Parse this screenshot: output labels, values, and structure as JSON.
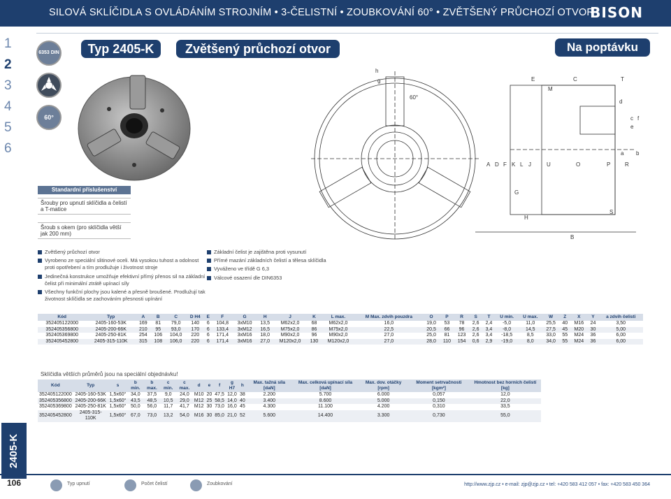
{
  "header": {
    "title": "SILOVÁ SKLÍČIDLA S OVLÁDÁNÍM STROJNÍM • 3-ČELISTNÍ • ZOUBKOVÁNÍ 60° • ZVĚTŠENÝ PRŮCHOZÍ OTVOR",
    "logo": "BISON"
  },
  "side_numbers": [
    "1",
    "2",
    "3",
    "4",
    "5",
    "6"
  ],
  "side_label": "2405-K",
  "icons": {
    "din": "6353 DIN",
    "angle": "60°"
  },
  "type_label": "Typ 2405-K",
  "subtitle": "Zvětšený průchozí otvor",
  "request_label": "Na poptávku",
  "accessories": {
    "heading": "Standardní příslušenství",
    "items": [
      "Šrouby pro upnutí sklíčidla a čelistí a T-matice",
      "Šroub s okem (pro sklíčidla větší jak 200 mm)"
    ]
  },
  "features_left": [
    "Zvětšený průchozí otvor",
    "Vyrobeno ze speciální slitinové oceli. Má vysokou tuhost a odolnost proti opotřebení a tím prodlužuje i životnost stroje",
    "Jedinečná konstrukce umožňuje efektivní přímý přenos sil na základní čelist při minimální ztrátě upínací síly",
    "Všechny funkční plochy jsou kalené a přesně broušené. Prodlužují tak životnost sklíčidla se zachováním přesnosti upínání"
  ],
  "features_right": [
    "Základní čelist je zajištěna proti vysunutí",
    "Přímé mazání základních čelistí a tělesa sklíčidla",
    "Vyváženo ve třídě G 6,3",
    "Válcové osazení dle DIN6353"
  ],
  "drawing_labels": {
    "front": [
      "h",
      "g",
      "60°"
    ],
    "section": [
      "E",
      "C",
      "T",
      "M",
      "d",
      "c",
      "e",
      "f",
      "a",
      "b",
      "A",
      "D",
      "F",
      "K",
      "L",
      "J",
      "U",
      "O",
      "P",
      "R",
      "G",
      "H",
      "S",
      "B"
    ]
  },
  "table1": {
    "headers": [
      "Kód",
      "Typ",
      "A",
      "B",
      "C",
      "D H4",
      "E",
      "F",
      "G",
      "H",
      "J",
      "K",
      "L max.",
      "M Max. zdvih pouzdra",
      "O",
      "P",
      "R",
      "S",
      "T",
      "U min.",
      "U max.",
      "W",
      "Z",
      "X",
      "Y",
      "a zdvih čelisti"
    ],
    "rows": [
      [
        "352405122000",
        "2405-160-53K",
        "169",
        "81",
        "79,0",
        "140",
        "6",
        "104,8",
        "3xM10",
        "13,5",
        "M62x2,0",
        "68",
        "M62x2,0",
        "16,0",
        "19,0",
        "53",
        "78",
        "2,6",
        "2,4",
        "-5,0",
        "11,0",
        "25,5",
        "40",
        "M16",
        "24",
        "3,50"
      ],
      [
        "352405356800",
        "2405-200-66K",
        "210",
        "95",
        "93,0",
        "170",
        "6",
        "133,4",
        "3xM12",
        "16,5",
        "M75x2,0",
        "86",
        "M75x2,0",
        "22,5",
        "20,5",
        "66",
        "96",
        "2,6",
        "3,4",
        "-8,0",
        "14,5",
        "27,5",
        "45",
        "M20",
        "30",
        "5,00"
      ],
      [
        "352405369800",
        "2405-250-81K",
        "254",
        "106",
        "104,0",
        "220",
        "6",
        "171,4",
        "3xM16",
        "18,0",
        "M90x2,0",
        "96",
        "M90x2,0",
        "27,0",
        "25,0",
        "81",
        "123",
        "2,6",
        "3,4",
        "-18,5",
        "8,5",
        "33,0",
        "55",
        "M24",
        "36",
        "6,00"
      ],
      [
        "352405452800",
        "2405-315-110K",
        "315",
        "108",
        "106,0",
        "220",
        "6",
        "171,4",
        "3xM16",
        "27,0",
        "M120x2,0",
        "130",
        "M120x2,0",
        "27,0",
        "28,0",
        "110",
        "154",
        "0,6",
        "2,9",
        "-19,0",
        "8,0",
        "34,0",
        "55",
        "M24",
        "36",
        "6,00"
      ]
    ]
  },
  "note": "Sklíčidla větších průměrů jsou na speciální objednávku!",
  "table2": {
    "headers": [
      "Kód",
      "Typ",
      "s",
      "b min.",
      "b max.",
      "c min.",
      "c max.",
      "d",
      "e",
      "f",
      "g H7",
      "h",
      "Max. tažná síla [daN]",
      "Max. celková upínací síla [daN]",
      "Max. dov. otáčky [rpm]",
      "Moment setrvačnosti [kgm²]",
      "Hmotnost bez horních čelistí [kg]"
    ],
    "rows": [
      [
        "352405122000",
        "2405-160-53K",
        "1,5x60°",
        "34,0",
        "37,5",
        "9,0",
        "24,0",
        "M10",
        "20",
        "47,5",
        "12,0",
        "38",
        "2.200",
        "5.700",
        "6.000",
        "0,057",
        "12,0"
      ],
      [
        "352405356800",
        "2405-200-66K",
        "1,5x60°",
        "43,5",
        "48,5",
        "10,5",
        "29,0",
        "M12",
        "25",
        "58,5",
        "14,0",
        "40",
        "3.400",
        "8.600",
        "5.000",
        "0,150",
        "22,0"
      ],
      [
        "352405369800",
        "2405-250-81K",
        "1,5x60°",
        "50,0",
        "56,0",
        "11,7",
        "41,7",
        "M12",
        "30",
        "73,0",
        "16,0",
        "45",
        "4.300",
        "11.100",
        "4.200",
        "0,310",
        "33,5"
      ],
      [
        "352405452800",
        "2405-315-110K",
        "1,5x60°",
        "67,0",
        "73,0",
        "13,2",
        "54,0",
        "M16",
        "30",
        "85,0",
        "21,0",
        "52",
        "5.600",
        "14.400",
        "3.300",
        "0,730",
        "55,0"
      ]
    ]
  },
  "footer": {
    "page": "106",
    "items": [
      "Typ upnutí",
      "Počet čelistí",
      "Zoubkování"
    ],
    "contact": "http://www.zjp.cz  •  e-mail: zjp@zjp.cz  •  tel: +420 583 412 057  •  fax: +420 583 450 364"
  },
  "colors": {
    "primary": "#1e3f6e",
    "accent": "#5c7393",
    "table_header": "#d6dde8"
  }
}
